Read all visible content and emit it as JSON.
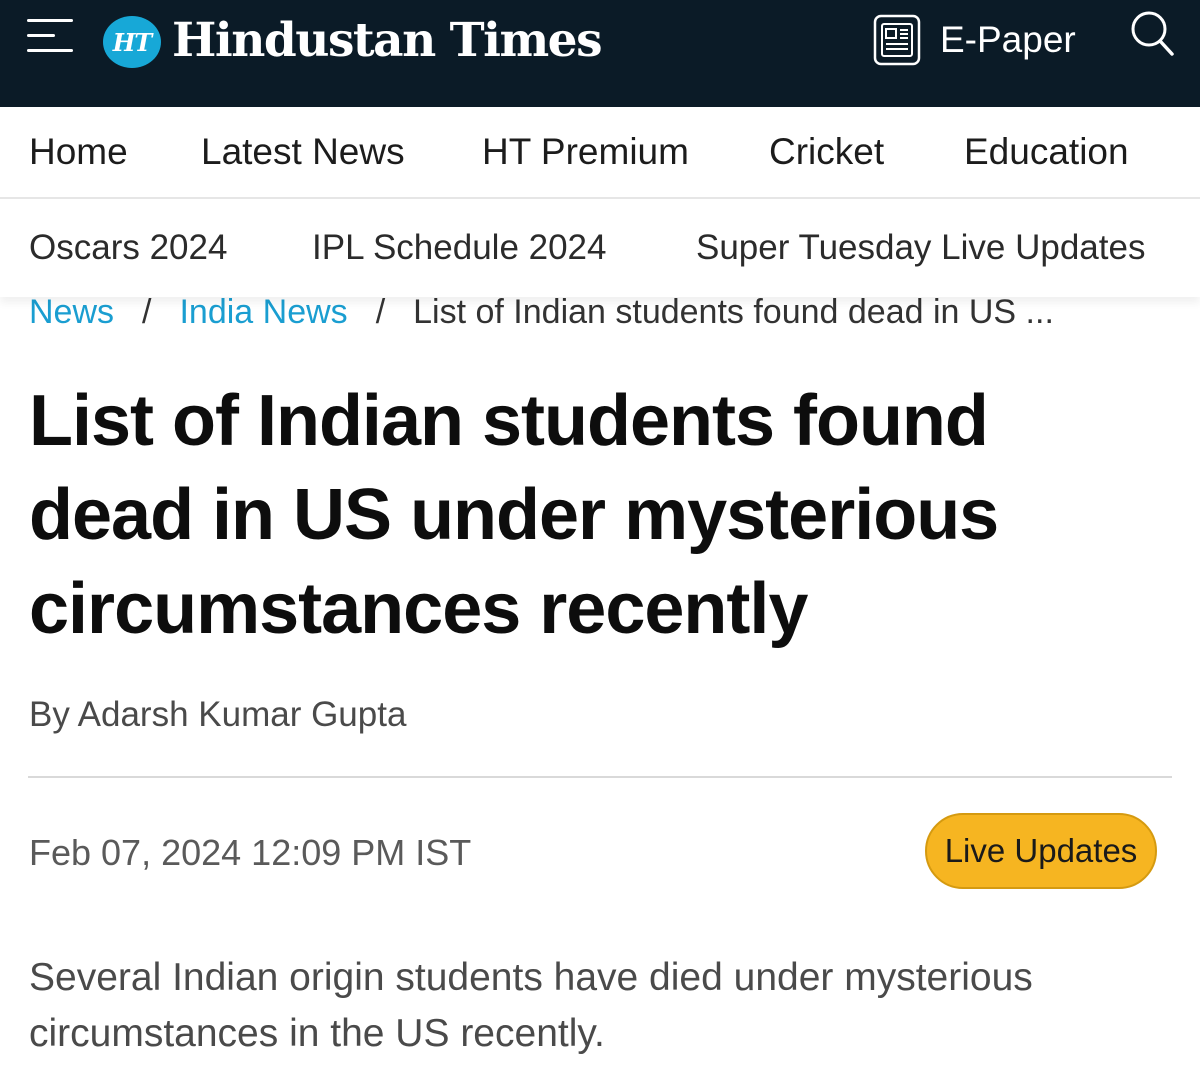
{
  "header": {
    "logo_badge": "HT",
    "logo_text": "Hindustan Times",
    "epaper_label": "E-Paper",
    "icons": {
      "menu": "hamburger-menu-icon",
      "epaper": "newspaper-icon",
      "search": "search-icon"
    },
    "colors": {
      "background": "#0b1b27",
      "badge": "#17a8d7"
    }
  },
  "primary_nav": [
    {
      "label": "Home"
    },
    {
      "label": "Latest News"
    },
    {
      "label": "HT Premium"
    },
    {
      "label": "Cricket"
    },
    {
      "label": "Education"
    }
  ],
  "secondary_nav": [
    {
      "label": "Oscars 2024"
    },
    {
      "label": "IPL Schedule 2024"
    },
    {
      "label": "Super Tuesday Live Updates"
    }
  ],
  "breadcrumb": {
    "items": [
      "News",
      "India News"
    ],
    "separator": "/",
    "current": "List of Indian students found dead in US ..."
  },
  "article": {
    "headline": "List of Indian students found dead in US under mysterious circumstances recently",
    "byline": "By Adarsh Kumar Gupta",
    "timestamp": "Feb 07, 2024 12:09 PM IST",
    "live_badge": "Live Updates",
    "summary": "Several Indian origin students have died under mysterious circumstances in the US recently."
  },
  "colors": {
    "link": "#1a9ed1",
    "live_badge": "#f6b521"
  }
}
